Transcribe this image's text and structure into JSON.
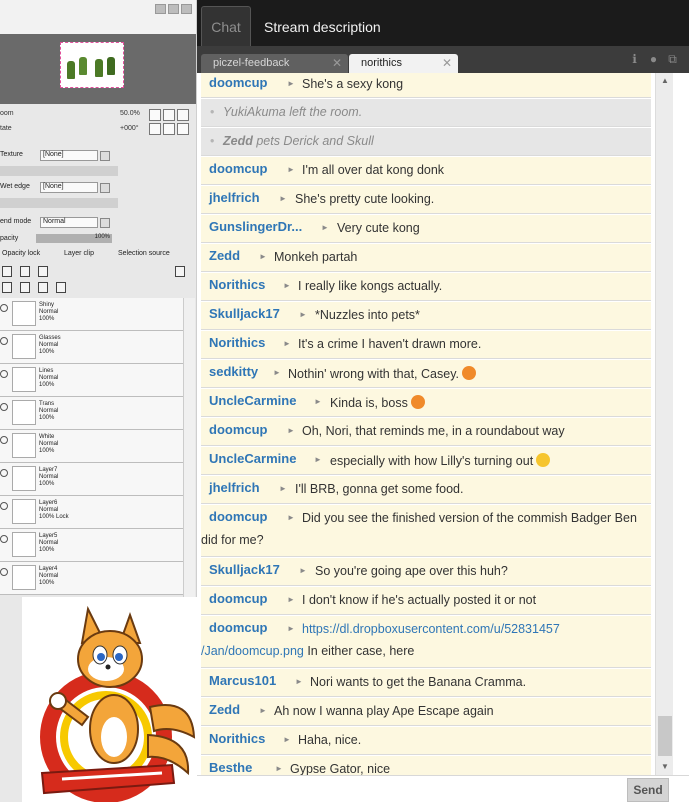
{
  "sai": {
    "zoom_label": "oom",
    "zoom_value": "50.0%",
    "rotate_label": "tate",
    "rotate_value": "+000°",
    "texture_label": "Texture",
    "texture_value": "[None]",
    "wet_edge_label": "Wet edge",
    "wet_edge_value": "[None]",
    "blend_mode_label": "end mode",
    "blend_mode_value": "Normal",
    "opacity_label": "pacity",
    "opacity_value": "100%",
    "opacity_lock_label": "Opacity lock",
    "layer_clip_label": "Layer clip",
    "selection_source_label": "Selection source",
    "layers": [
      {
        "name": "Shiny",
        "mode": "Normal",
        "opacity": "100%"
      },
      {
        "name": "Glasses",
        "mode": "Normal",
        "opacity": "100%"
      },
      {
        "name": "Lines",
        "mode": "Normal",
        "opacity": "100%"
      },
      {
        "name": "Trans",
        "mode": "Normal",
        "opacity": "100%"
      },
      {
        "name": "White",
        "mode": "Normal",
        "opacity": "100%"
      },
      {
        "name": "Layer7",
        "mode": "Normal",
        "opacity": "100%"
      },
      {
        "name": "Layer6",
        "mode": "Normal",
        "opacity": "100% Lock"
      },
      {
        "name": "Layer5",
        "mode": "Normal",
        "opacity": "100%"
      },
      {
        "name": "Layer4",
        "mode": "Normal",
        "opacity": "100%"
      }
    ]
  },
  "header": {
    "tab_chat": "Chat",
    "tab_stream_description": "Stream description"
  },
  "rooms": {
    "inactive": "piczel-feedback",
    "active": "norithics"
  },
  "messages": [
    {
      "user": "doomcup",
      "text": "She's a sexy kong"
    },
    {
      "notice": "YukiAkuma left the room."
    },
    {
      "notice_user": "Zedd",
      "notice_text": " pets Derick and Skull"
    },
    {
      "user": "doomcup",
      "text": "I'm all over dat kong donk"
    },
    {
      "user": "jhelfrich",
      "text": "She's pretty cute looking."
    },
    {
      "user": "GunslingerDr...",
      "text": "Very cute kong"
    },
    {
      "user": "Zedd",
      "text": "Monkeh partah"
    },
    {
      "user": "Norithics",
      "text": "I really like kongs actually."
    },
    {
      "user": "Skulljack17",
      "text": "*Nuzzles into pets*"
    },
    {
      "user": "Norithics",
      "text": "It's a crime I haven't drawn more."
    },
    {
      "user": "sedkitty",
      "text": "Nothin' wrong with that, Casey."
    },
    {
      "user": "UncleCarmine",
      "text": "Kinda is, boss"
    },
    {
      "user": "doomcup",
      "text": "Oh, Nori, that reminds me, in a roundabout way"
    },
    {
      "user": "UncleCarmine",
      "text": "especially with how Lilly's turning out"
    },
    {
      "user": "jhelfrich",
      "text": "I'll BRB, gonna get some food."
    },
    {
      "user": "doomcup",
      "text": "Did you see the finished version of the commish Badger Ben",
      "cont": "did for me?"
    },
    {
      "user": "Skulljack17",
      "text": "So you're going ape over this huh?"
    },
    {
      "user": "doomcup",
      "text": "I don't know if he's actually posted it or not"
    },
    {
      "user": "doomcup",
      "link": "https://dl.dropboxusercontent.com/u/52831457",
      "link2": "/Jan/doomcup.png",
      "cont2": " In either case, here"
    },
    {
      "user": "Marcus101",
      "text": "Nori wants to get the Banana Cramma."
    },
    {
      "user": "Zedd",
      "text": "Ah now I wanna play Ape Escape again"
    },
    {
      "user": "Norithics",
      "text": "Haha, nice."
    },
    {
      "user": "Besthe",
      "text": "Gypse Gator, nice"
    }
  ],
  "send_label": "Send",
  "colors": {
    "username": "#2f76b6",
    "message_bg": "#fdf8e0",
    "header_bg": "#1b1b1b"
  }
}
